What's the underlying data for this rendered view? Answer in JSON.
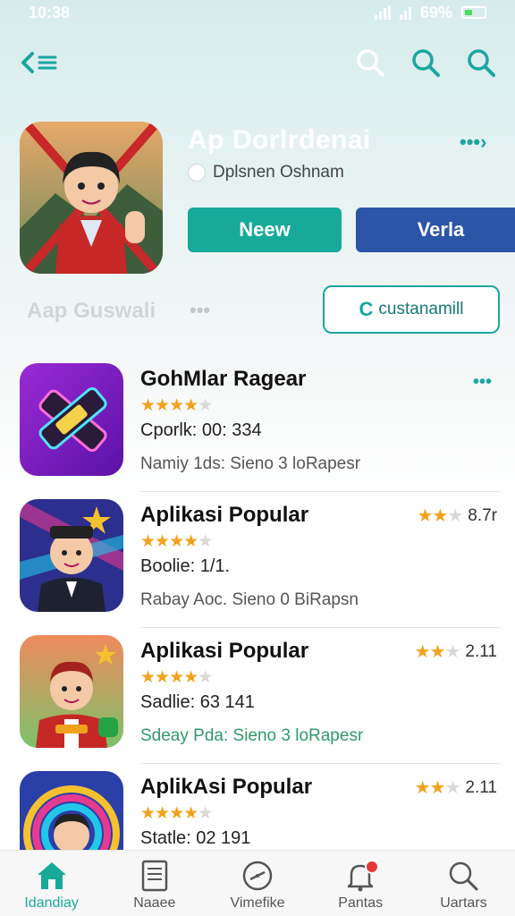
{
  "status_bar": {
    "time": "10:38",
    "battery": "69%"
  },
  "header": {
    "app_title": "Ap Dorlrdenai",
    "subtitle": "Dplsnen Oshnam",
    "primary_button": "Neew",
    "secondary_button": "Verla"
  },
  "section": {
    "title": "Aap Guswali",
    "dots": "•••",
    "action_button": "custanamill"
  },
  "apps": [
    {
      "title": "GohMlar Ragear",
      "rating": 4,
      "meta1": "Cporlk: 00: 334",
      "meta2": "Namiy 1ds: Sieno 3 loRapesr",
      "right_text": "",
      "right_rating": 0,
      "more": "•••"
    },
    {
      "title": "Aplikasi Popular",
      "rating": 4,
      "meta1": "Boolie: 1/1.",
      "meta2": "Rabay Aoc. Sieno 0 BiRapsn",
      "right_text": "8.7r",
      "right_rating": 2,
      "more": ""
    },
    {
      "title": "Aplikasi Popular",
      "rating": 4,
      "meta1": "Sadlie: 63 141",
      "meta2": "Sdeay Pda: Sieno 3 loRapesr",
      "right_text": "2.11",
      "right_rating": 2,
      "more": ""
    },
    {
      "title": "AplikAsi Popular",
      "rating": 4,
      "meta1": "Statle: 02 191",
      "meta2": "",
      "right_text": "2.11",
      "right_rating": 2,
      "more": ""
    }
  ],
  "bottom_nav": [
    {
      "label": "Idandiay",
      "icon": "home-icon",
      "active": true
    },
    {
      "label": "Naaee",
      "icon": "document-icon",
      "active": false
    },
    {
      "label": "Vimefike",
      "icon": "compass-icon",
      "active": false
    },
    {
      "label": "Pantas",
      "icon": "bell-icon",
      "active": false
    },
    {
      "label": "Uartars",
      "icon": "search-icon",
      "active": false
    }
  ],
  "colors": {
    "accent": "#17a99a",
    "secondary": "#2c55a8",
    "star": "#f0a21c"
  }
}
